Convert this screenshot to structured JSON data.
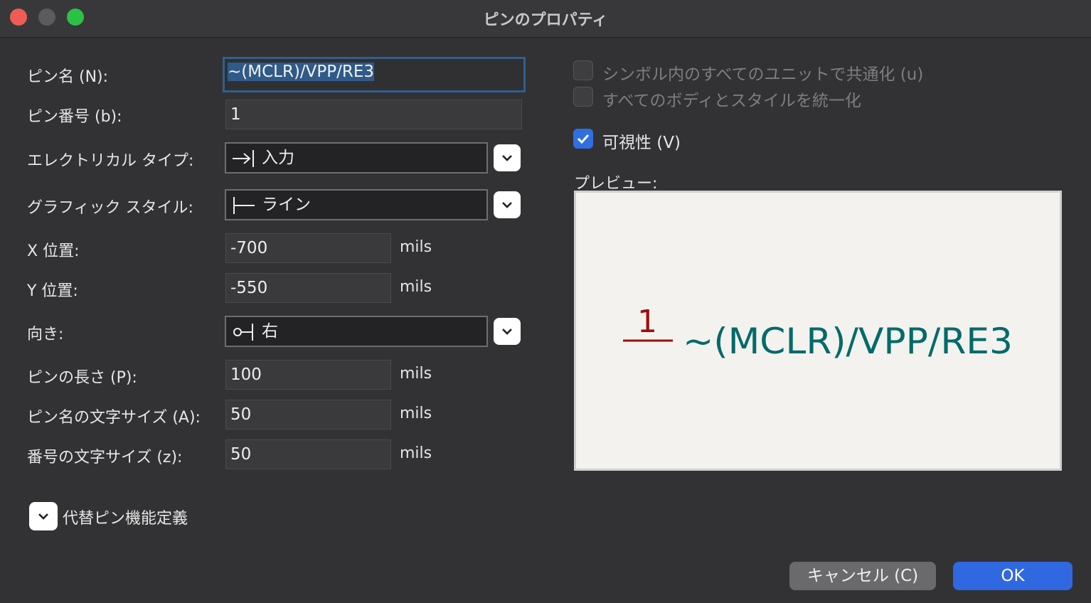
{
  "window": {
    "title": "ピンのプロパティ"
  },
  "form": {
    "pin_name": {
      "label": "ピン名 (N):",
      "value": "~(MCLR)/VPP/RE3"
    },
    "pin_number": {
      "label": "ピン番号 (b):",
      "value": "1"
    },
    "electrical_type": {
      "label": "エレクトリカル タイプ:",
      "value": "入力",
      "icon": "input-pin-icon"
    },
    "graphic_style": {
      "label": "グラフィック スタイル:",
      "value": "ライン",
      "icon": "line-pin-icon"
    },
    "x_position": {
      "label": "X 位置:",
      "value": "-700",
      "unit": "mils"
    },
    "y_position": {
      "label": "Y 位置:",
      "value": "-550",
      "unit": "mils"
    },
    "orientation": {
      "label": "向き:",
      "value": "右",
      "icon": "orientation-right-icon"
    },
    "pin_length": {
      "label": "ピンの長さ (P):",
      "value": "100",
      "unit": "mils"
    },
    "name_text_size": {
      "label": "ピン名の文字サイズ (A):",
      "value": "50",
      "unit": "mils"
    },
    "number_text_size": {
      "label": "番号の文字サイズ (z):",
      "value": "50",
      "unit": "mils"
    }
  },
  "options": {
    "common_to_units": {
      "label": "シンボル内のすべてのユニットで共通化 (u)",
      "checked": false,
      "enabled": false
    },
    "common_to_body_styles": {
      "label": "すべてのボディとスタイルを統一化",
      "checked": false,
      "enabled": false
    },
    "visible": {
      "label": "可視性 (V)",
      "checked": true,
      "enabled": true
    }
  },
  "preview": {
    "label": "プレビュー:",
    "pin_number": "1",
    "pin_name": "~(MCLR)/VPP/RE3",
    "colors": {
      "background": "#f3f2ee",
      "pin": "#9a1010",
      "name": "#006a6a"
    }
  },
  "alternates": {
    "label": "代替ピン機能定義"
  },
  "buttons": {
    "cancel": "キャンセル (C)",
    "ok": "OK"
  },
  "colors": {
    "accent": "#2f68e0",
    "focus_ring": "#2f5f8f"
  }
}
